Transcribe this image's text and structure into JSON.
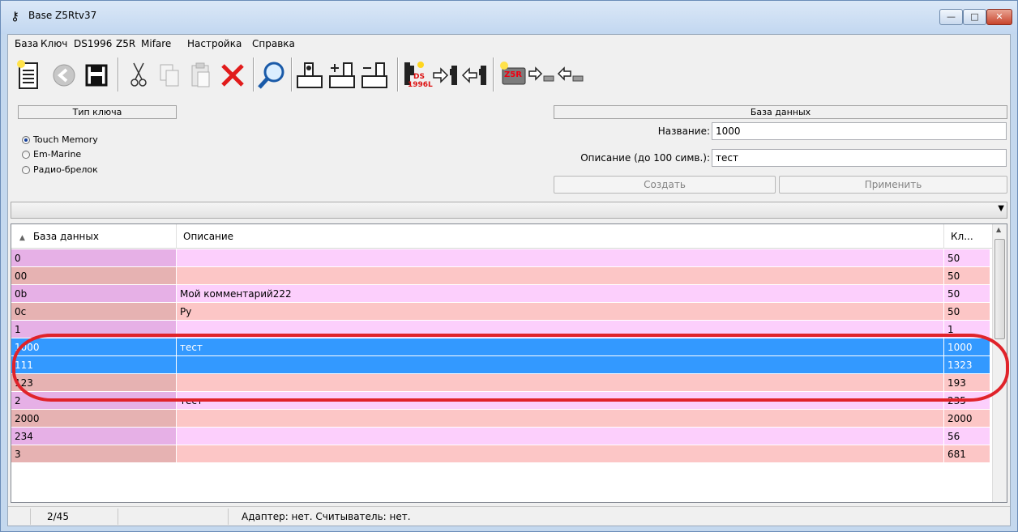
{
  "window": {
    "title": "Base Z5Rtv37",
    "minimize": "—",
    "maximize": "□",
    "close": "✕"
  },
  "menu": [
    "База",
    "Ключ",
    "DS1996",
    "Z5R",
    "Mifare",
    "Настройка",
    "Справка"
  ],
  "toolbar": {
    "icons": [
      "new-file-icon",
      "back-arrow-icon",
      "save-icon",
      "cut-icon",
      "copy-icon",
      "paste-icon",
      "delete-icon",
      "search-icon",
      "read-key-icon",
      "add-key-icon",
      "remove-key-icon",
      "ds1996l-icon",
      "key-export-icon",
      "key-import-icon",
      "z5r-controller-icon",
      "chip-export-icon",
      "chip-import-icon"
    ],
    "ds_label_top": "DS",
    "ds_label_bottom": "1996L",
    "z5r_label": "Z5R"
  },
  "key_type": {
    "header": "Тип ключа",
    "options": [
      {
        "label": "Touch Memory",
        "selected": true
      },
      {
        "label": "Em-Marine",
        "selected": false
      },
      {
        "label": "Радио-брелок",
        "selected": false
      }
    ]
  },
  "database": {
    "header": "База данных",
    "name_label": "Название:",
    "name_value": "1000",
    "desc_label": "Описание (до 100 симв.):",
    "desc_value": "тест",
    "create_label": "Создать",
    "apply_label": "Применить"
  },
  "grid": {
    "sort_indicator": "▲",
    "columns": [
      "База данных",
      "Описание",
      "Кл..."
    ],
    "rows": [
      {
        "name": "0",
        "desc": "",
        "count": "50",
        "selected": false
      },
      {
        "name": "00",
        "desc": "",
        "count": "50",
        "selected": false
      },
      {
        "name": "0b",
        "desc": "Мой комментарий222",
        "count": "50",
        "selected": false
      },
      {
        "name": "0c",
        "desc": "Ру",
        "count": "50",
        "selected": false
      },
      {
        "name": "1",
        "desc": "",
        "count": "1",
        "selected": false
      },
      {
        "name": "1000",
        "desc": "тест",
        "count": "1000",
        "selected": true
      },
      {
        "name": "111",
        "desc": "",
        "count": "1323",
        "selected": true
      },
      {
        "name": "123",
        "desc": "",
        "count": "193",
        "selected": false
      },
      {
        "name": "2",
        "desc": "тест",
        "count": "235",
        "selected": false
      },
      {
        "name": "2000",
        "desc": "",
        "count": "2000",
        "selected": false
      },
      {
        "name": "234",
        "desc": "",
        "count": "56",
        "selected": false
      },
      {
        "name": "3",
        "desc": "",
        "count": "681",
        "selected": false
      }
    ]
  },
  "status": {
    "position": "2/45",
    "message": "Адаптер: нет. Считыватель: нет."
  },
  "colors": {
    "row_pink": "#fccffc",
    "row_salmon": "#fcc6c6",
    "col1_pink": "#e6b0e6",
    "col1_salmon": "#e6b2b2",
    "selection": "#3399ff",
    "annotation": "#e0232a"
  }
}
